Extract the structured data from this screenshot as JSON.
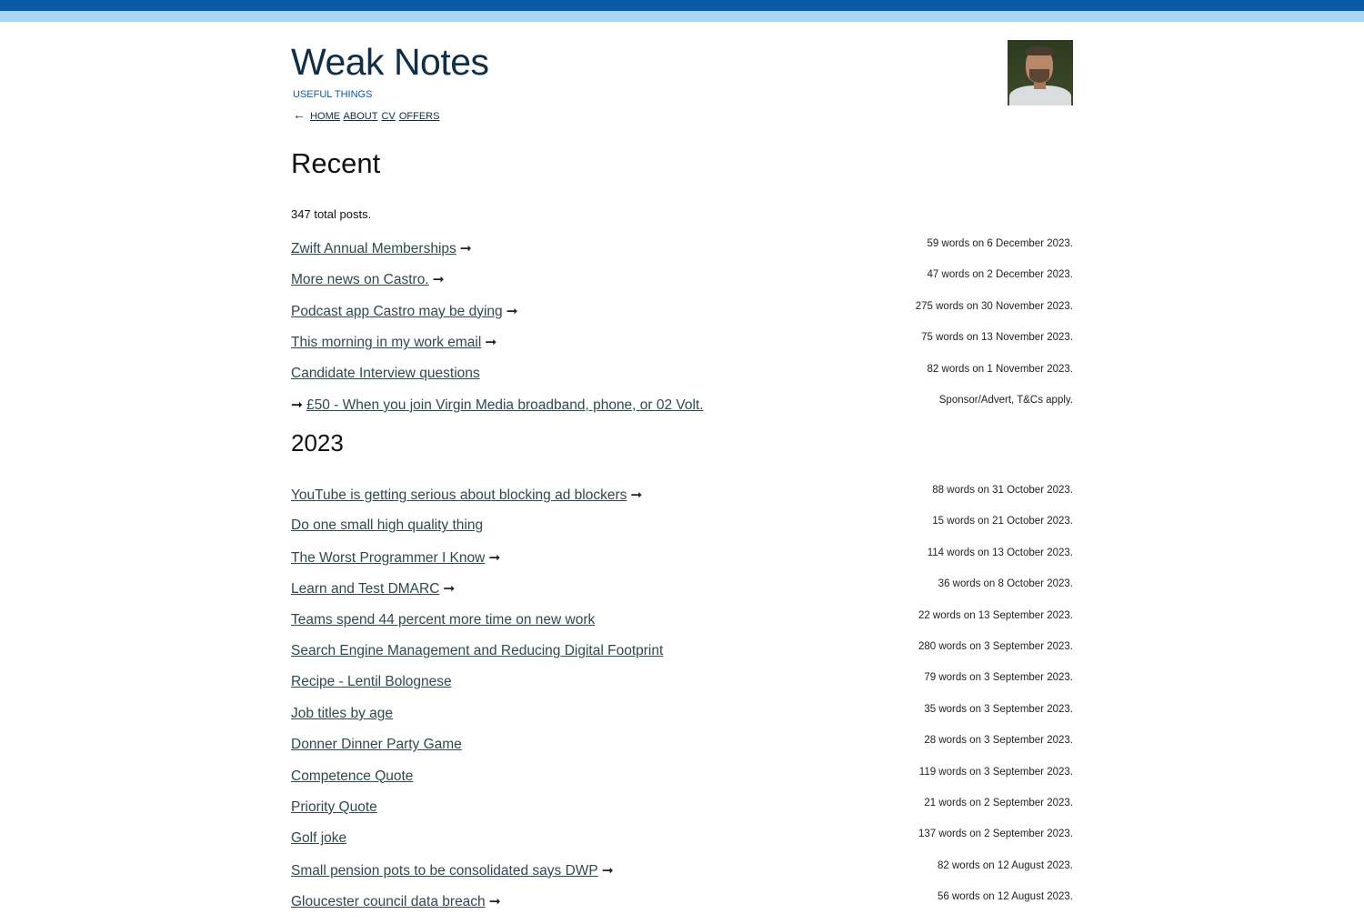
{
  "site": {
    "title": "Weak Notes",
    "tagline": "Useful Things",
    "nav_back_icon": "←",
    "nav": [
      "Home",
      "About",
      "CV",
      "Offers"
    ]
  },
  "colors": {
    "bar_dark": "#0b5aa8",
    "bar_light": "#abd6f0",
    "link": "#2e4a4f",
    "title": "#0f2e47"
  },
  "recent": {
    "heading": "Recent",
    "total_count": "347",
    "total_suffix": "total posts.",
    "posts": [
      {
        "title": "Zwift Annual Memberships",
        "arrow": "➞",
        "meta": "59 words on 6 December 2023."
      },
      {
        "title": "More news on Castro.",
        "arrow": "➞",
        "meta": "47 words on 2 December 2023."
      },
      {
        "title": "Podcast app Castro may be dying",
        "arrow": "➞",
        "meta": "275 words on 30 November 2023."
      },
      {
        "title": "This morning in my work email",
        "arrow": "➞",
        "meta": "75 words on 13 November 2023."
      },
      {
        "title": "Candidate Interview questions",
        "arrow": "",
        "meta": "82 words on 1 November 2023."
      }
    ],
    "advert": {
      "arrow": "➞",
      "title": "£50 - When you join Virgin Media broadband, phone, or 02 Volt.",
      "meta": "Sponsor/Advert, T&Cs apply."
    }
  },
  "year_2023": {
    "heading": "2023",
    "posts": [
      {
        "title": "YouTube is getting serious about blocking ad blockers",
        "arrow": "➞",
        "meta": "88 words on 31 October 2023."
      },
      {
        "title": "Do one small high quality thing",
        "arrow": "",
        "meta": "15 words on 21 October 2023."
      },
      {
        "title": "The Worst Programmer I Know",
        "arrow": "➞",
        "meta": "114 words on 13 October 2023."
      },
      {
        "title": "Learn and Test DMARC",
        "arrow": "➞",
        "meta": "36 words on 8 October 2023."
      },
      {
        "title": "Teams spend 44 percent more time on new work",
        "arrow": "",
        "meta": "22 words on 13 September 2023."
      },
      {
        "title": "Search Engine Management and Reducing Digital Footprint",
        "arrow": "",
        "meta": "280 words on 3 September 2023."
      },
      {
        "title": "Recipe - Lentil Bolognese",
        "arrow": "",
        "meta": "79 words on 3 September 2023."
      },
      {
        "title": "Job titles by age",
        "arrow": "",
        "meta": "35 words on 3 September 2023."
      },
      {
        "title": "Donner Dinner Party Game",
        "arrow": "",
        "meta": "28 words on 3 September 2023."
      },
      {
        "title": "Competence Quote",
        "arrow": "",
        "meta": "119 words on 3 September 2023."
      },
      {
        "title": "Priority Quote",
        "arrow": "",
        "meta": "21 words on 2 September 2023."
      },
      {
        "title": "Golf joke",
        "arrow": "",
        "meta": "137 words on 2 September 2023."
      },
      {
        "title": "Small pension pots to be consolidated says DWP",
        "arrow": "➞",
        "meta": "82 words on 12 August 2023."
      },
      {
        "title": "Gloucester council data breach",
        "arrow": "➞",
        "meta": "56 words on 12 August 2023."
      }
    ]
  }
}
